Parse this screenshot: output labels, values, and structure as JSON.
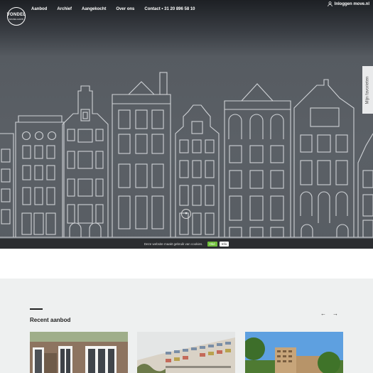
{
  "header": {
    "logo": {
      "line1": "VONDEL",
      "line2": "MAKELAARS"
    },
    "nav": [
      "Aanbod",
      "Archief",
      "Aangekocht",
      "Over ons",
      "Contact • 31 20 896 58 10"
    ],
    "login": {
      "label": "Inloggen move.nl",
      "icon": "user-icon"
    }
  },
  "favorites_tab": "Mijn favorieten",
  "scroll_down": {
    "glyph": "▾",
    "icon": "chevron-down-icon"
  },
  "cookie_bar": {
    "message": "Deze website maakt gebruik van cookies.",
    "ok": "Oké",
    "info": "Info"
  },
  "recent": {
    "title": "Recent aanbod",
    "prev": "←",
    "next": "→"
  },
  "colors": {
    "hero": "#585d63",
    "accept": "#6fbf3a",
    "section_bg": "#eef0f0"
  }
}
